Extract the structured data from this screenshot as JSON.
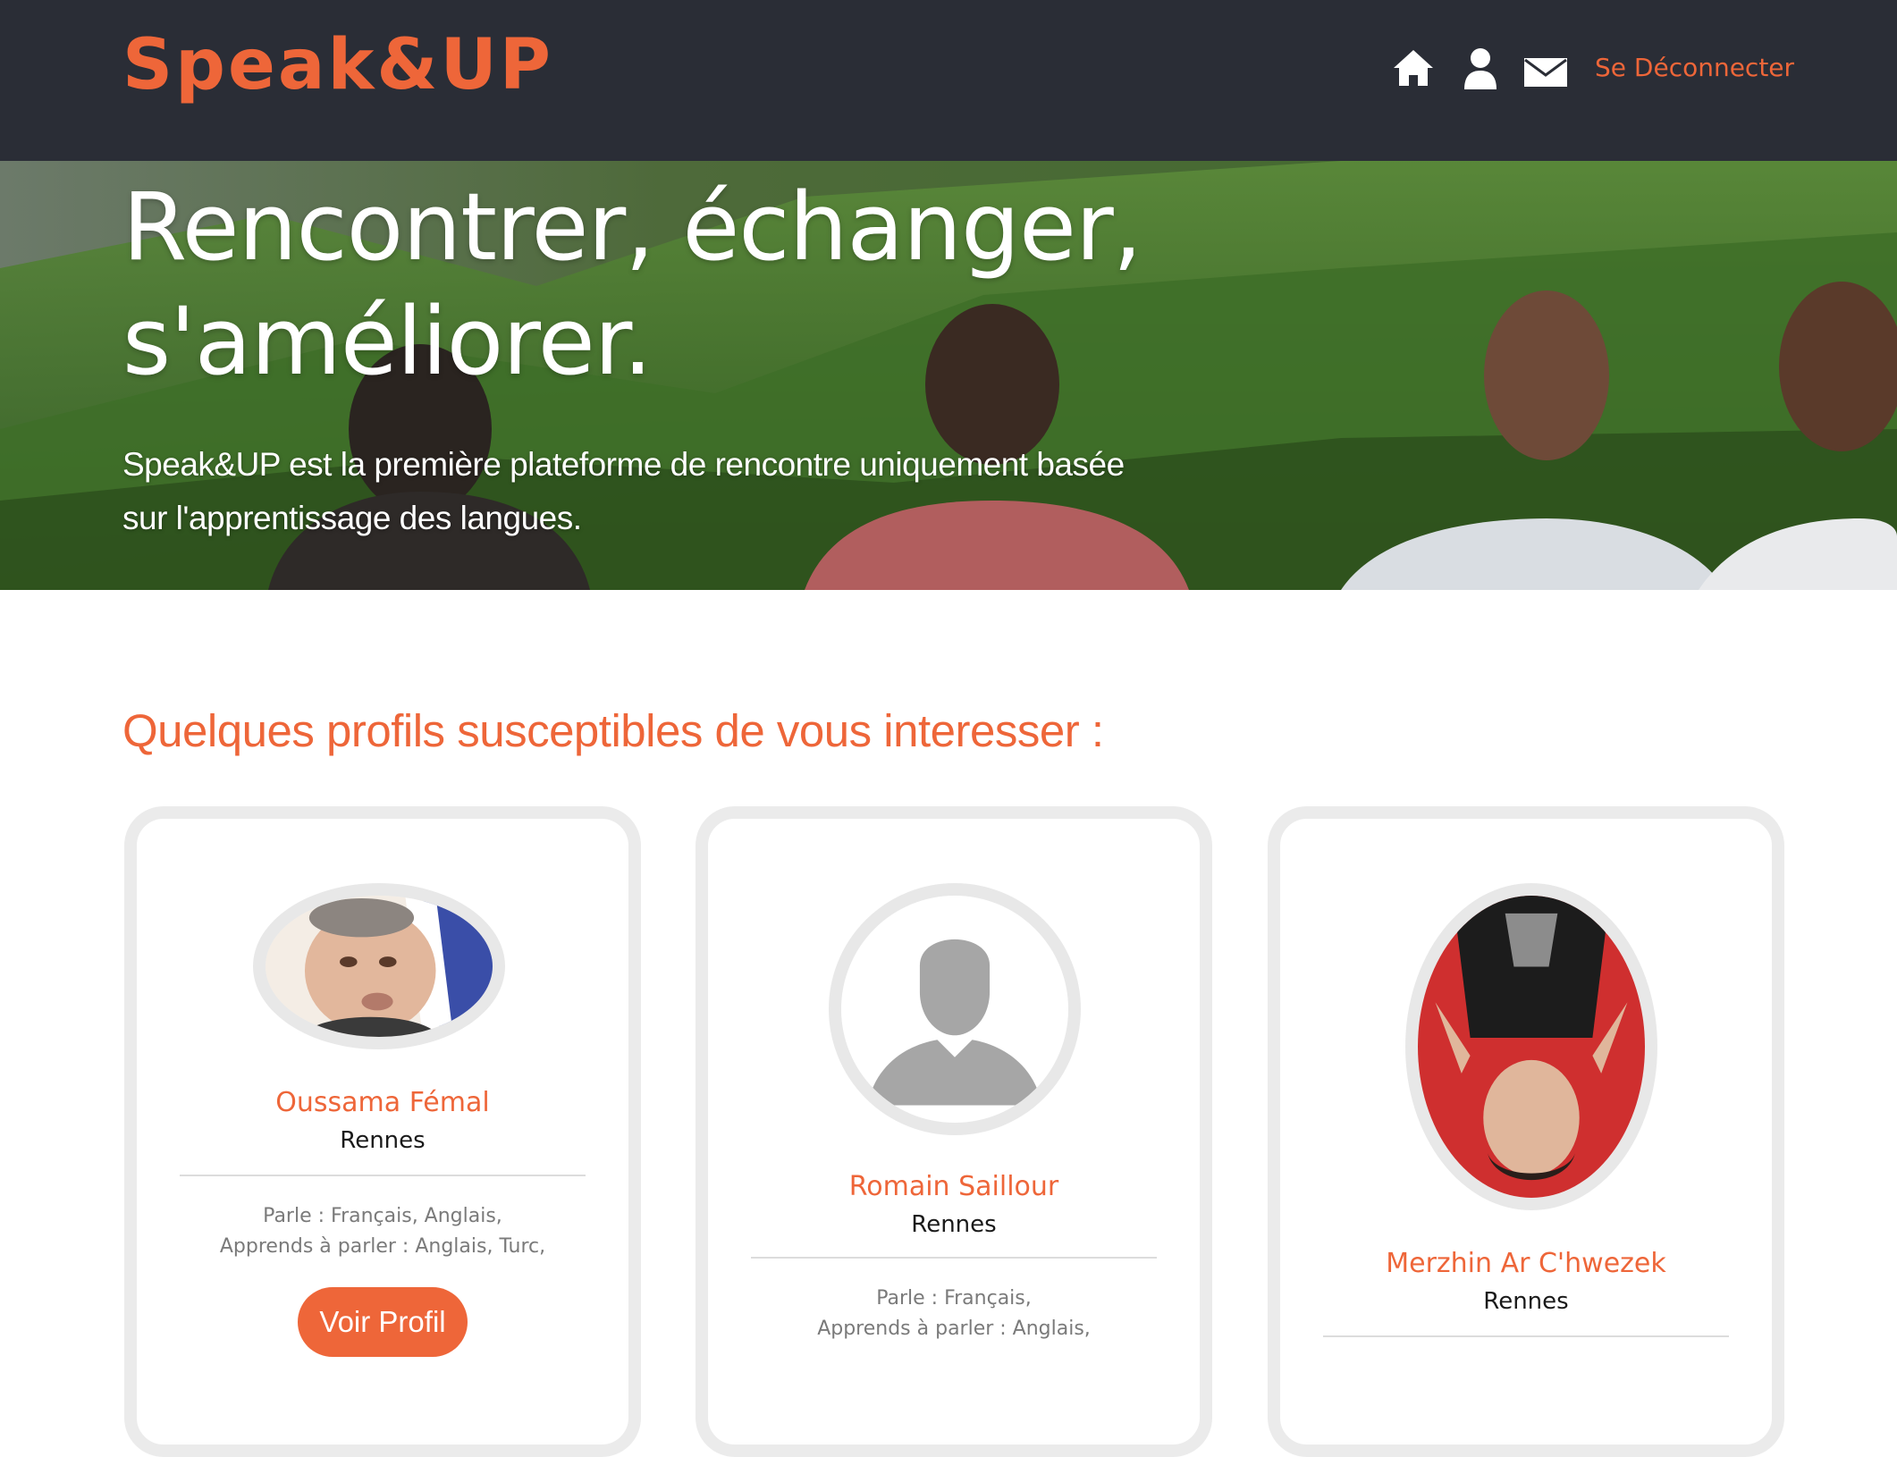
{
  "brand": {
    "logo_text": "Speak&UP",
    "accent_color": "#ee6639",
    "header_bg": "#2a2d36"
  },
  "nav": {
    "icons": [
      "home-icon",
      "user-icon",
      "mail-icon"
    ],
    "logout_label": "Se Déconnecter"
  },
  "hero": {
    "title_line1": "Rencontrer, échanger,",
    "title_line2": "s'améliorer.",
    "subtitle_line1": "Speak&UP est la première plateforme de rencontre uniquement basée",
    "subtitle_line2": "sur l'apprentissage des langues."
  },
  "profiles_section": {
    "title": "Quelques profils susceptibles de vous interesser :",
    "profiles": [
      {
        "name": "Oussama Fémal",
        "city": "Rennes",
        "speaks": "Parle : Français, Anglais,",
        "learns": "Apprends à parler : Anglais, Turc,",
        "button_label": "Voir Profil",
        "avatar": "photo-man-portrait"
      },
      {
        "name": "Romain Saillour",
        "city": "Rennes",
        "speaks": "Parle : Français,",
        "learns": "Apprends à parler : Anglais,",
        "avatar": "default-avatar"
      },
      {
        "name": "Merzhin Ar C'hwezek",
        "city": "Rennes",
        "avatar": "photo-upside-down-person"
      }
    ]
  }
}
